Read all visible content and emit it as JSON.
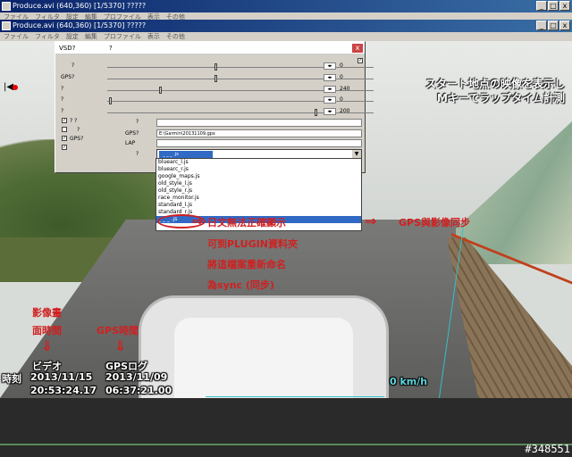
{
  "window1": {
    "title": "Produce.avi (640,360)  [1/5370]  ?????"
  },
  "window2": {
    "title": "Produce.avi (640,360)  [1/5370]  ?????"
  },
  "menu": [
    "ファイル",
    "フィルタ",
    "設定",
    "編集",
    "プロファイル",
    "表示",
    "その他"
  ],
  "dialog": {
    "title": "VSD?",
    "title_q": "?",
    "close": "x",
    "sliders": [
      {
        "label": "?",
        "value": "0"
      },
      {
        "label": "GPS?",
        "value": "0"
      },
      {
        "label": "?",
        "value": "240"
      },
      {
        "label": "?",
        "value": "0"
      },
      {
        "label": "?",
        "value": "200"
      }
    ],
    "checks": [
      {
        "label": "? ?",
        "checked": "✓"
      },
      {
        "label": "?",
        "checked": ""
      },
      {
        "label": "GPS?",
        "checked": "✓"
      },
      {
        "label": "",
        "checked": "✓"
      }
    ],
    "mid_label_1": "?",
    "gps_label": "GPS?",
    "gps_file": "E:\\Garmin\\20131109.gpx",
    "lap_label": "LAP",
    "skin_label": "?",
    "select_value": "_ _ _ .js",
    "select_arrow": "▼"
  },
  "dropdown": [
    "bluearc_l.js",
    "bluearc_r.js",
    "google_maps.js",
    "old_style_l.js",
    "old_style_r.js",
    "race_monitor.js",
    "standard_l.js",
    "standard_r.js",
    "_ _ _ .js"
  ],
  "annotations": {
    "jp_line1": "スタート地点の映像を表示し",
    "jp_line2": "Mキーでラップタイム計測",
    "note1": "日文無法正確顯示",
    "note2": "可到PLUGIN資料夾",
    "note3": "將這檔案重新命名",
    "note4": "為sync (同步)",
    "gps_sync": "GPS與影像同步",
    "video_time1": "影像畫",
    "video_time2": "面時間",
    "gps_time": "GPS時間",
    "video_label": "ビデオ",
    "gps_log_label": "GPSログ",
    "time_prefix": "時刻",
    "video_date": "2013/11/15",
    "video_clock": "20:53:24.17",
    "gps_date": "2013/11/09",
    "gps_clock": "06:37:21.00",
    "speed": "0 km/h"
  },
  "watermark": "#348551"
}
